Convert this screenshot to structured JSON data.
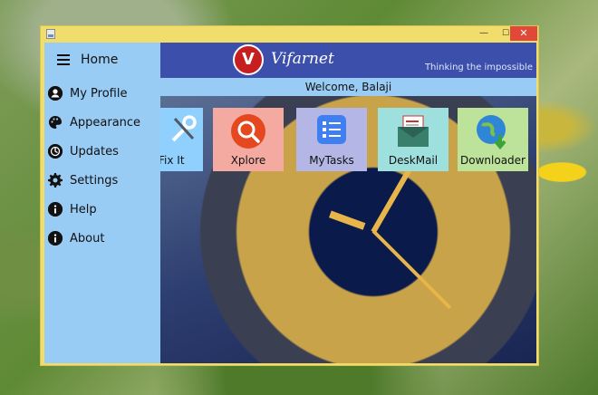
{
  "window": {
    "close_glyph": "✕",
    "max_glyph": "☐",
    "min_glyph": "—"
  },
  "sidebar": {
    "home_label": "Home",
    "items": [
      {
        "label": "My Profile",
        "icon": "person-icon"
      },
      {
        "label": "Appearance",
        "icon": "palette-icon"
      },
      {
        "label": "Updates",
        "icon": "updates-icon"
      },
      {
        "label": "Settings",
        "icon": "gear-icon"
      },
      {
        "label": "Help",
        "icon": "info-icon"
      },
      {
        "label": "About",
        "icon": "info-icon"
      }
    ]
  },
  "header": {
    "logo_letter": "V",
    "brand": "Vifarnet",
    "tagline": "Thinking the impossible",
    "welcome": "Welcome, Balaji"
  },
  "tiles": [
    {
      "label": "Fix It",
      "icon": "tools-icon",
      "color": "#8fd0ff"
    },
    {
      "label": "Xplore",
      "icon": "search-icon",
      "color": "#f4aaa0"
    },
    {
      "label": "MyTasks",
      "icon": "checklist-icon",
      "color": "#b4b7e6"
    },
    {
      "label": "DeskMail",
      "icon": "mail-icon",
      "color": "#9ee0dd"
    },
    {
      "label": "Downloader",
      "icon": "globe-download-icon",
      "color": "#bde39a"
    }
  ],
  "colors": {
    "window_frame": "#f0dd6c",
    "sidebar": "#99ccf5",
    "banner": "#3c4fab",
    "close": "#e0493a"
  }
}
